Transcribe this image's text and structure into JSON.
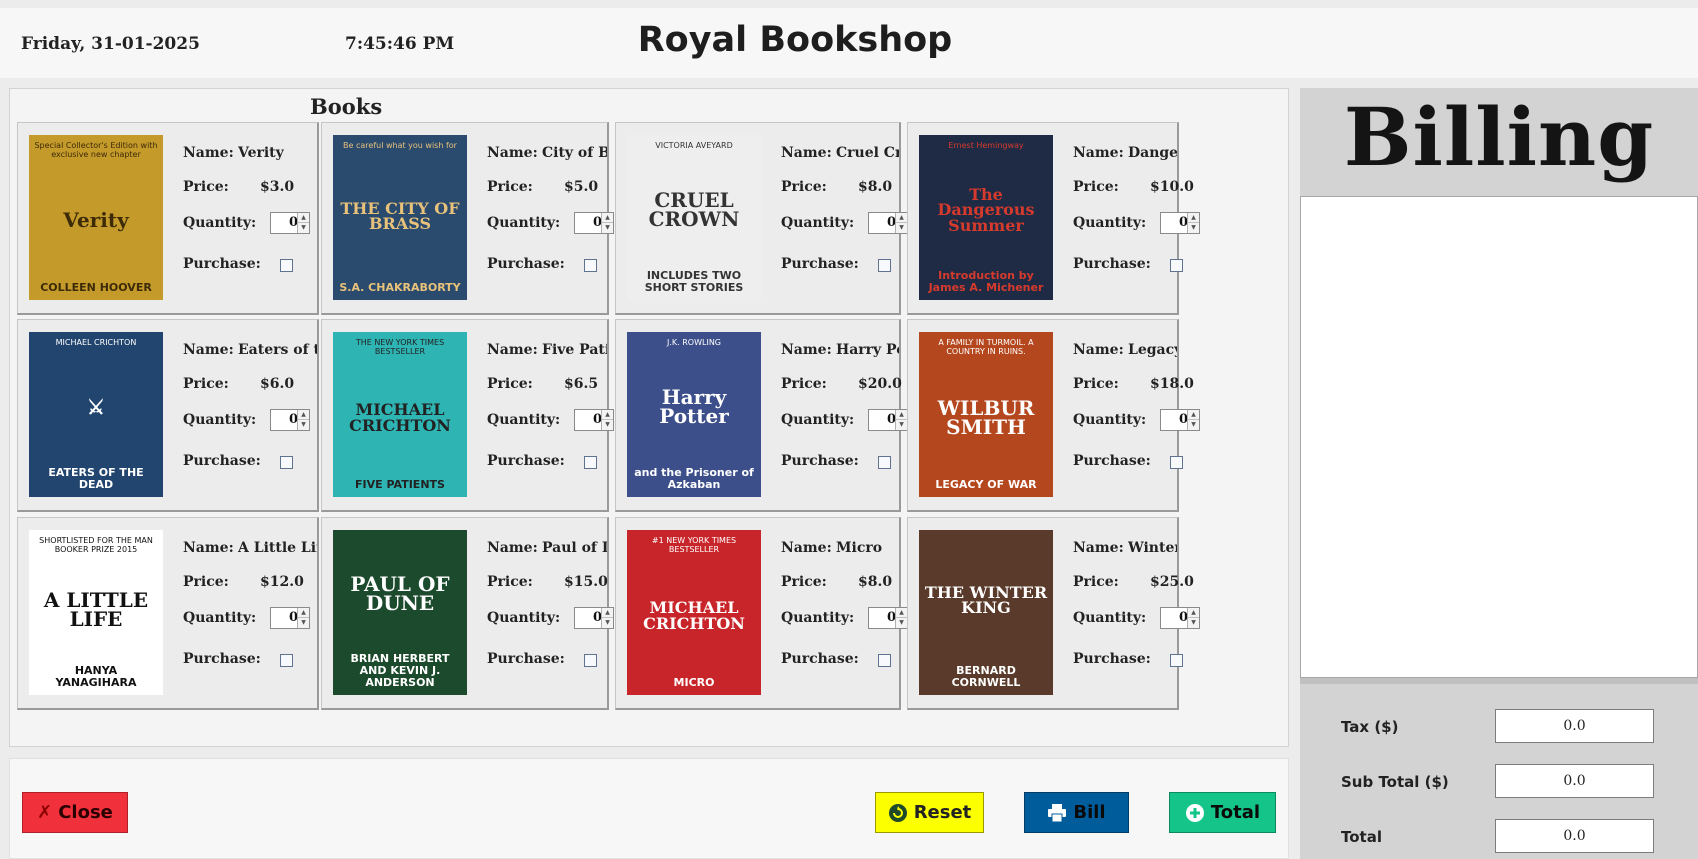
{
  "header": {
    "date": "Friday, 31-01-2025",
    "time": "7:45:46 PM",
    "title": "Royal Bookshop"
  },
  "books_panel": {
    "title": "Books",
    "labels": {
      "name": "Name:",
      "price": "Price:",
      "quantity": "Quantity:",
      "purchase": "Purchase:"
    }
  },
  "books": [
    {
      "name": "Verity",
      "price": "$3.0",
      "quantity": "0",
      "purchased": false,
      "cover": {
        "top": "Special Collector's Edition with exclusive new chapter",
        "mid": "Verity",
        "bot": "COLLEEN HOOVER",
        "bg": "#c49a2a",
        "fg": "#3d2b08"
      }
    },
    {
      "name": "City of Brass",
      "price": "$5.0",
      "quantity": "0",
      "purchased": false,
      "cover": {
        "top": "Be careful what you wish for",
        "mid": "THE CITY OF BRASS",
        "bot": "S.A. CHAKRABORTY",
        "bg": "#2a4a6e",
        "fg": "#e8c27a"
      }
    },
    {
      "name": "Cruel Crown",
      "price": "$8.0",
      "quantity": "0",
      "purchased": false,
      "cover": {
        "top": "VICTORIA AVEYARD",
        "mid": "CRUEL CROWN",
        "bot": "INCLUDES TWO SHORT STORIES",
        "bg": "#eeeeee",
        "fg": "#333333"
      }
    },
    {
      "name": "Dangerous Summer",
      "price": "$10.0",
      "quantity": "0",
      "purchased": false,
      "cover": {
        "top": "Ernest Hemingway",
        "mid": "The Dangerous Summer",
        "bot": "Introduction by James A. Michener",
        "bg": "#1f2b44",
        "fg": "#d63a2c"
      }
    },
    {
      "name": "Eaters of the death",
      "price": "$6.0",
      "quantity": "0",
      "purchased": false,
      "cover": {
        "top": "MICHAEL CRICHTON",
        "mid": "⚔",
        "bot": "EATERS OF THE DEAD",
        "bg": "#21456e",
        "fg": "#ffffff"
      }
    },
    {
      "name": "Five Patients",
      "price": "$6.5",
      "quantity": "0",
      "purchased": false,
      "cover": {
        "top": "THE NEW YORK TIMES BESTSELLER",
        "mid": "MICHAEL CRICHTON",
        "bot": "FIVE PATIENTS",
        "bg": "#2fb4b4",
        "fg": "#222222"
      }
    },
    {
      "name": "Harry Potter",
      "price": "$20.0",
      "quantity": "0",
      "purchased": false,
      "cover": {
        "top": "J.K. ROWLING",
        "mid": "Harry Potter",
        "bot": "and the Prisoner of Azkaban",
        "bg": "#3c4f8a",
        "fg": "#ffffff"
      }
    },
    {
      "name": "Legacy Of War",
      "price": "$18.0",
      "quantity": "0",
      "purchased": false,
      "cover": {
        "top": "A FAMILY IN TURMOIL. A COUNTRY IN RUINS.",
        "mid": "WILBUR SMITH",
        "bot": "LEGACY OF WAR",
        "bg": "#b5471f",
        "fg": "#ffffff"
      }
    },
    {
      "name": "A Little Life",
      "price": "$12.0",
      "quantity": "0",
      "purchased": false,
      "cover": {
        "top": "SHORTLISTED FOR THE MAN BOOKER PRIZE 2015",
        "mid": "A LITTLE LIFE",
        "bot": "HANYA YANAGIHARA",
        "bg": "#ffffff",
        "fg": "#111111"
      }
    },
    {
      "name": "Paul of Dune",
      "price": "$15.0",
      "quantity": "0",
      "purchased": false,
      "cover": {
        "top": "",
        "mid": "PAUL OF DUNE",
        "bot": "BRIAN HERBERT AND KEVIN J. ANDERSON",
        "bg": "#1c4a2c",
        "fg": "#ffffff"
      }
    },
    {
      "name": "Micro",
      "price": "$8.0",
      "quantity": "0",
      "purchased": false,
      "cover": {
        "top": "#1 NEW YORK TIMES BESTSELLER",
        "mid": "MICHAEL CRICHTON",
        "bot": "MICRO",
        "bg": "#c8252a",
        "fg": "#ffffff"
      }
    },
    {
      "name": "Winter King",
      "price": "$25.0",
      "quantity": "0",
      "purchased": false,
      "cover": {
        "top": "",
        "mid": "THE WINTER KING",
        "bot": "BERNARD CORNWELL",
        "bg": "#5a3a2a",
        "fg": "#ffffff"
      }
    }
  ],
  "footer": {
    "close_label": "Close",
    "reset_label": "Reset",
    "bill_label": "Bill",
    "total_label": "Total"
  },
  "billing": {
    "title": "Billing",
    "tax_label": "Tax ($)",
    "tax_value": "0.0",
    "subtotal_label": "Sub Total ($)",
    "subtotal_value": "0.0",
    "total_label": "Total",
    "total_value": "0.0"
  },
  "colors": {
    "close_btn": "#f0313b",
    "reset_btn": "#fbff00",
    "bill_btn": "#005c9a",
    "total_btn": "#14c488"
  }
}
